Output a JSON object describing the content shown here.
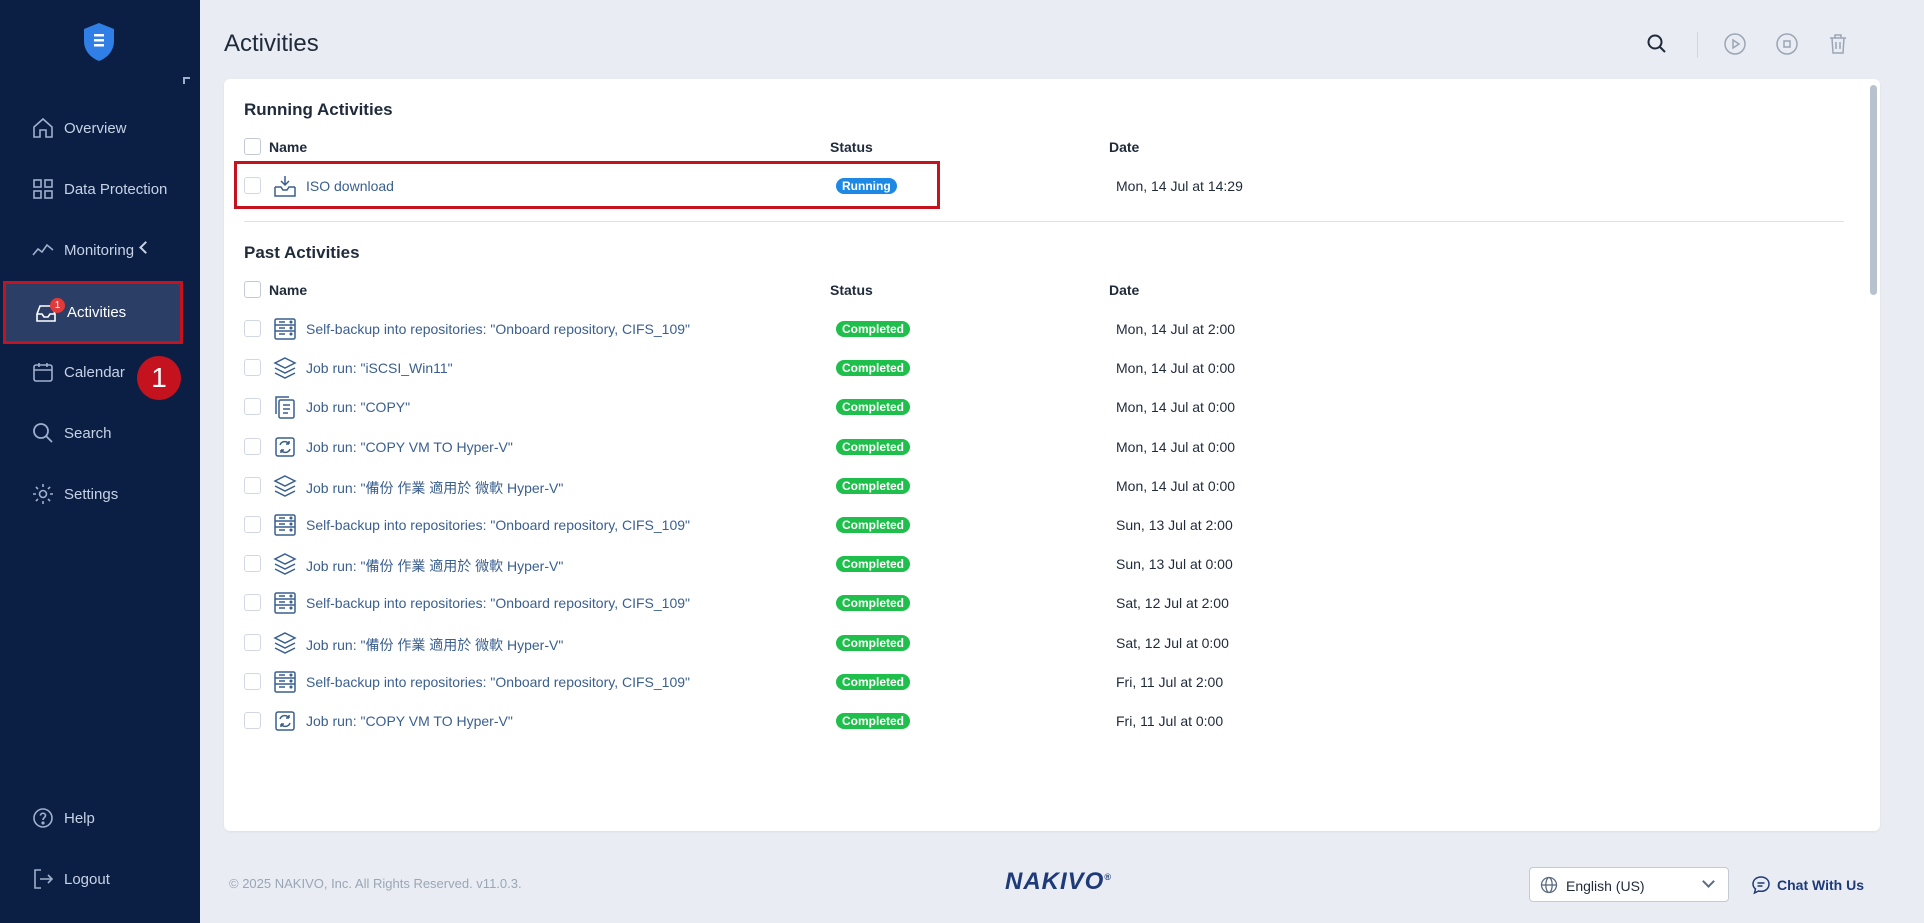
{
  "app": {
    "title": "Activities"
  },
  "sidebar": {
    "items": [
      {
        "key": "overview",
        "label": "Overview"
      },
      {
        "key": "data-protection",
        "label": "Data Protection"
      },
      {
        "key": "monitoring",
        "label": "Monitoring"
      },
      {
        "key": "activities",
        "label": "Activities",
        "badge": "1"
      },
      {
        "key": "calendar",
        "label": "Calendar"
      },
      {
        "key": "search",
        "label": "Search"
      },
      {
        "key": "settings",
        "label": "Settings"
      },
      {
        "key": "help",
        "label": "Help"
      },
      {
        "key": "logout",
        "label": "Logout"
      }
    ],
    "step_marker": "1"
  },
  "running": {
    "title": "Running Activities",
    "columns": {
      "name": "Name",
      "status": "Status",
      "date": "Date"
    },
    "rows": [
      {
        "name": "ISO download",
        "status": "Running",
        "date": "Mon, 14 Jul at 14:29",
        "icon": "download-tray-icon"
      }
    ]
  },
  "past": {
    "title": "Past Activities",
    "columns": {
      "name": "Name",
      "status": "Status",
      "date": "Date"
    },
    "rows": [
      {
        "name": "Self-backup into repositories: \"Onboard repository, CIFS_109\"",
        "status": "Completed",
        "date": "Mon, 14 Jul at 2:00",
        "icon": "repository-icon"
      },
      {
        "name": "Job run: \"iSCSI_Win11\"",
        "status": "Completed",
        "date": "Mon, 14 Jul at 0:00",
        "icon": "backup-job-icon"
      },
      {
        "name": "Job run: \"COPY\"",
        "status": "Completed",
        "date": "Mon, 14 Jul at 0:00",
        "icon": "copy-job-icon"
      },
      {
        "name": "Job run: \"COPY VM TO Hyper-V\"",
        "status": "Completed",
        "date": "Mon, 14 Jul at 0:00",
        "icon": "replication-job-icon"
      },
      {
        "name": "Job run: \"備份 作業 適用於 微軟 Hyper-V\"",
        "status": "Completed",
        "date": "Mon, 14 Jul at 0:00",
        "icon": "backup-job-icon"
      },
      {
        "name": "Self-backup into repositories: \"Onboard repository, CIFS_109\"",
        "status": "Completed",
        "date": "Sun, 13 Jul at 2:00",
        "icon": "repository-icon"
      },
      {
        "name": "Job run: \"備份 作業 適用於 微軟 Hyper-V\"",
        "status": "Completed",
        "date": "Sun, 13 Jul at 0:00",
        "icon": "backup-job-icon"
      },
      {
        "name": "Self-backup into repositories: \"Onboard repository, CIFS_109\"",
        "status": "Completed",
        "date": "Sat, 12 Jul at 2:00",
        "icon": "repository-icon"
      },
      {
        "name": "Job run: \"備份 作業 適用於 微軟 Hyper-V\"",
        "status": "Completed",
        "date": "Sat, 12 Jul at 0:00",
        "icon": "backup-job-icon"
      },
      {
        "name": "Self-backup into repositories: \"Onboard repository, CIFS_109\"",
        "status": "Completed",
        "date": "Fri, 11 Jul at 2:00",
        "icon": "repository-icon"
      },
      {
        "name": "Job run: \"COPY VM TO Hyper-V\"",
        "status": "Completed",
        "date": "Fri, 11 Jul at 0:00",
        "icon": "replication-job-icon"
      }
    ]
  },
  "footer": {
    "copyright": "© 2025 NAKIVO, Inc. All Rights Reserved. v11.0.3.",
    "brand": "NAKIVO",
    "brand_mark": "®",
    "language": "English (US)",
    "chat": "Chat With Us"
  },
  "colors": {
    "sidebar_bg": "#0b1f45",
    "accent": "#3a5f8f",
    "completed": "#1fbf4b",
    "running": "#1e88e5",
    "highlight": "#c4121f"
  }
}
